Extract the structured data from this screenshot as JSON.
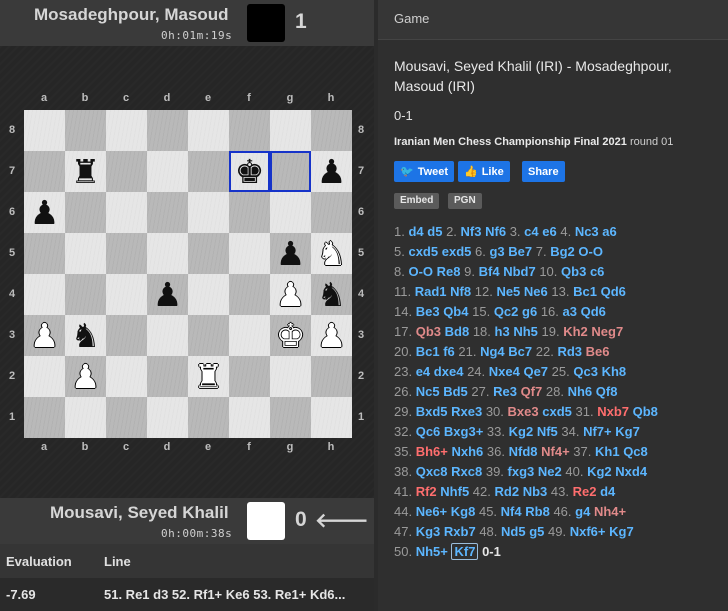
{
  "top_player": {
    "name": "Mosadeghpour, Masoud",
    "clock": "0h:01m:19s",
    "score": "1",
    "color": "#000000"
  },
  "bottom_player": {
    "name": "Mousavi, Seyed Khalil",
    "clock": "0h:00m:38s",
    "score": "0",
    "arrow": "🡐",
    "color": "#ffffff"
  },
  "board": {
    "files": [
      "a",
      "b",
      "c",
      "d",
      "e",
      "f",
      "g",
      "h"
    ],
    "ranks": [
      "8",
      "7",
      "6",
      "5",
      "4",
      "3",
      "2",
      "1"
    ],
    "pieces": [
      {
        "sq": "b7",
        "glyph": "♜",
        "side": "b",
        "icon": "black-rook-icon"
      },
      {
        "sq": "f7",
        "glyph": "♚",
        "side": "b",
        "icon": "black-king-icon"
      },
      {
        "sq": "h7",
        "glyph": "♟",
        "side": "b",
        "icon": "black-pawn-icon"
      },
      {
        "sq": "a6",
        "glyph": "♟",
        "side": "b",
        "icon": "black-pawn-icon"
      },
      {
        "sq": "g5",
        "glyph": "♟",
        "side": "b",
        "icon": "black-pawn-icon"
      },
      {
        "sq": "h5",
        "glyph": "♞",
        "side": "w",
        "icon": "white-knight-icon"
      },
      {
        "sq": "d4",
        "glyph": "♟",
        "side": "b",
        "icon": "black-pawn-icon"
      },
      {
        "sq": "g4",
        "glyph": "♟",
        "side": "w",
        "icon": "white-pawn-icon"
      },
      {
        "sq": "h4",
        "glyph": "♞",
        "side": "b",
        "icon": "black-knight-icon"
      },
      {
        "sq": "a3",
        "glyph": "♟",
        "side": "w",
        "icon": "white-pawn-icon"
      },
      {
        "sq": "b3",
        "glyph": "♞",
        "side": "b",
        "icon": "black-knight-icon"
      },
      {
        "sq": "g3",
        "glyph": "♚",
        "side": "w",
        "icon": "white-king-icon"
      },
      {
        "sq": "h3",
        "glyph": "♟",
        "side": "w",
        "icon": "white-pawn-icon"
      },
      {
        "sq": "b2",
        "glyph": "♟",
        "side": "w",
        "icon": "white-pawn-icon"
      },
      {
        "sq": "e2",
        "glyph": "♜",
        "side": "w",
        "icon": "white-rook-icon"
      }
    ],
    "highlight": [
      "f7",
      "g7"
    ],
    "highlight_color": "#1633c9"
  },
  "eval_table": {
    "headers": {
      "evaluation": "Evaluation",
      "line": "Line"
    },
    "row": {
      "evaluation": "-7.69",
      "line": "51. Re1 d3 52. Rf1+ Ke6 53. Re1+ Kd6..."
    }
  },
  "panel": {
    "tab": "Game",
    "title": "Mousavi, Seyed Khalil (IRI) - Mosadeghpour, Masoud (IRI)",
    "result": "0-1",
    "event": "Iranian Men Chess Championship Final 2021",
    "round": "round 01",
    "share": {
      "tweet": "Tweet",
      "like": "Like",
      "share": "Share"
    },
    "buttons": {
      "embed": "Embed",
      "pgn": "PGN"
    }
  },
  "moves": [
    [
      [
        "n",
        "1."
      ],
      [
        "m",
        "d4"
      ],
      [
        "m",
        "d5"
      ],
      [
        "n",
        "2."
      ],
      [
        "m",
        "Nf3"
      ],
      [
        "m",
        "Nf6"
      ],
      [
        "n",
        "3."
      ],
      [
        "m",
        "c4"
      ],
      [
        "m",
        "e6"
      ],
      [
        "n",
        "4."
      ],
      [
        "m",
        "Nc3"
      ],
      [
        "m",
        "a6"
      ]
    ],
    [
      [
        "n",
        "5."
      ],
      [
        "m",
        "cxd5"
      ],
      [
        "m",
        "exd5"
      ],
      [
        "n",
        "6."
      ],
      [
        "m",
        "g3"
      ],
      [
        "m",
        "Be7"
      ],
      [
        "n",
        "7."
      ],
      [
        "m",
        "Bg2"
      ],
      [
        "m",
        "O-O"
      ]
    ],
    [
      [
        "n",
        "8."
      ],
      [
        "m",
        "O-O"
      ],
      [
        "m",
        "Re8"
      ],
      [
        "n",
        "9."
      ],
      [
        "m",
        "Bf4"
      ],
      [
        "m",
        "Nbd7"
      ],
      [
        "n",
        "10."
      ],
      [
        "m",
        "Qb3"
      ],
      [
        "m",
        "c6"
      ]
    ],
    [
      [
        "n",
        "11."
      ],
      [
        "m",
        "Rad1"
      ],
      [
        "m",
        "Nf8"
      ],
      [
        "n",
        "12."
      ],
      [
        "m",
        "Ne5"
      ],
      [
        "m",
        "Ne6"
      ],
      [
        "n",
        "13."
      ],
      [
        "m",
        "Bc1"
      ],
      [
        "m",
        "Qd6"
      ]
    ],
    [
      [
        "n",
        "14."
      ],
      [
        "m",
        "Be3"
      ],
      [
        "m",
        "Qb4"
      ],
      [
        "n",
        "15."
      ],
      [
        "m",
        "Qc2"
      ],
      [
        "m",
        "g6"
      ],
      [
        "n",
        "16."
      ],
      [
        "m",
        "a3"
      ],
      [
        "m",
        "Qd6"
      ]
    ],
    [
      [
        "n",
        "17."
      ],
      [
        "p",
        "Qb3"
      ],
      [
        "m",
        "Bd8"
      ],
      [
        "n",
        "18."
      ],
      [
        "m",
        "h3"
      ],
      [
        "m",
        "Nh5"
      ],
      [
        "n",
        "19."
      ],
      [
        "p",
        "Kh2"
      ],
      [
        "p",
        "Neg7"
      ]
    ],
    [
      [
        "n",
        "20."
      ],
      [
        "m",
        "Bc1"
      ],
      [
        "m",
        "f6"
      ],
      [
        "n",
        "21."
      ],
      [
        "m",
        "Ng4"
      ],
      [
        "m",
        "Bc7"
      ],
      [
        "n",
        "22."
      ],
      [
        "m",
        "Rd3"
      ],
      [
        "p",
        "Be6"
      ]
    ],
    [
      [
        "n",
        "23."
      ],
      [
        "m",
        "e4"
      ],
      [
        "m",
        "dxe4"
      ],
      [
        "n",
        "24."
      ],
      [
        "m",
        "Nxe4"
      ],
      [
        "m",
        "Qe7"
      ],
      [
        "n",
        "25."
      ],
      [
        "m",
        "Qc3"
      ],
      [
        "m",
        "Kh8"
      ]
    ],
    [
      [
        "n",
        "26."
      ],
      [
        "m",
        "Nc5"
      ],
      [
        "m",
        "Bd5"
      ],
      [
        "n",
        "27."
      ],
      [
        "m",
        "Re3"
      ],
      [
        "p",
        "Qf7"
      ],
      [
        "n",
        "28."
      ],
      [
        "m",
        "Nh6"
      ],
      [
        "m",
        "Qf8"
      ]
    ],
    [
      [
        "n",
        "29."
      ],
      [
        "m",
        "Bxd5"
      ],
      [
        "m",
        "Rxe3"
      ],
      [
        "n",
        "30."
      ],
      [
        "p",
        "Bxe3"
      ],
      [
        "m",
        "cxd5"
      ],
      [
        "n",
        "31."
      ],
      [
        "r",
        "Nxb7"
      ],
      [
        "m",
        "Qb8"
      ]
    ],
    [
      [
        "n",
        "32."
      ],
      [
        "m",
        "Qc6"
      ],
      [
        "m",
        "Bxg3+"
      ],
      [
        "n",
        "33."
      ],
      [
        "m",
        "Kg2"
      ],
      [
        "m",
        "Nf5"
      ],
      [
        "n",
        "34."
      ],
      [
        "m",
        "Nf7+"
      ],
      [
        "m",
        "Kg7"
      ]
    ],
    [
      [
        "n",
        "35."
      ],
      [
        "r",
        "Bh6+"
      ],
      [
        "m",
        "Nxh6"
      ],
      [
        "n",
        "36."
      ],
      [
        "m",
        "Nfd8"
      ],
      [
        "p",
        "Nf4+"
      ],
      [
        "n",
        "37."
      ],
      [
        "m",
        "Kh1"
      ],
      [
        "m",
        "Qc8"
      ]
    ],
    [
      [
        "n",
        "38."
      ],
      [
        "m",
        "Qxc8"
      ],
      [
        "m",
        "Rxc8"
      ],
      [
        "n",
        "39."
      ],
      [
        "m",
        "fxg3"
      ],
      [
        "m",
        "Ne2"
      ],
      [
        "n",
        "40."
      ],
      [
        "m",
        "Kg2"
      ],
      [
        "m",
        "Nxd4"
      ]
    ],
    [
      [
        "n",
        "41."
      ],
      [
        "r",
        "Rf2"
      ],
      [
        "m",
        "Nhf5"
      ],
      [
        "n",
        "42."
      ],
      [
        "m",
        "Rd2"
      ],
      [
        "m",
        "Nb3"
      ],
      [
        "n",
        "43."
      ],
      [
        "r",
        "Re2"
      ],
      [
        "m",
        "d4"
      ]
    ],
    [
      [
        "n",
        "44."
      ],
      [
        "m",
        "Ne6+"
      ],
      [
        "m",
        "Kg8"
      ],
      [
        "n",
        "45."
      ],
      [
        "m",
        "Nf4"
      ],
      [
        "m",
        "Rb8"
      ],
      [
        "n",
        "46."
      ],
      [
        "m",
        "g4"
      ],
      [
        "p",
        "Nh4+"
      ]
    ],
    [
      [
        "n",
        "47."
      ],
      [
        "m",
        "Kg3"
      ],
      [
        "m",
        "Rxb7"
      ],
      [
        "n",
        "48."
      ],
      [
        "m",
        "Nd5"
      ],
      [
        "m",
        "g5"
      ],
      [
        "n",
        "49."
      ],
      [
        "m",
        "Nxf6+"
      ],
      [
        "m",
        "Kg7"
      ]
    ],
    [
      [
        "n",
        "50."
      ],
      [
        "m",
        "Nh5+"
      ],
      [
        "c",
        "Kf7"
      ],
      [
        "x",
        "0-1"
      ]
    ]
  ]
}
